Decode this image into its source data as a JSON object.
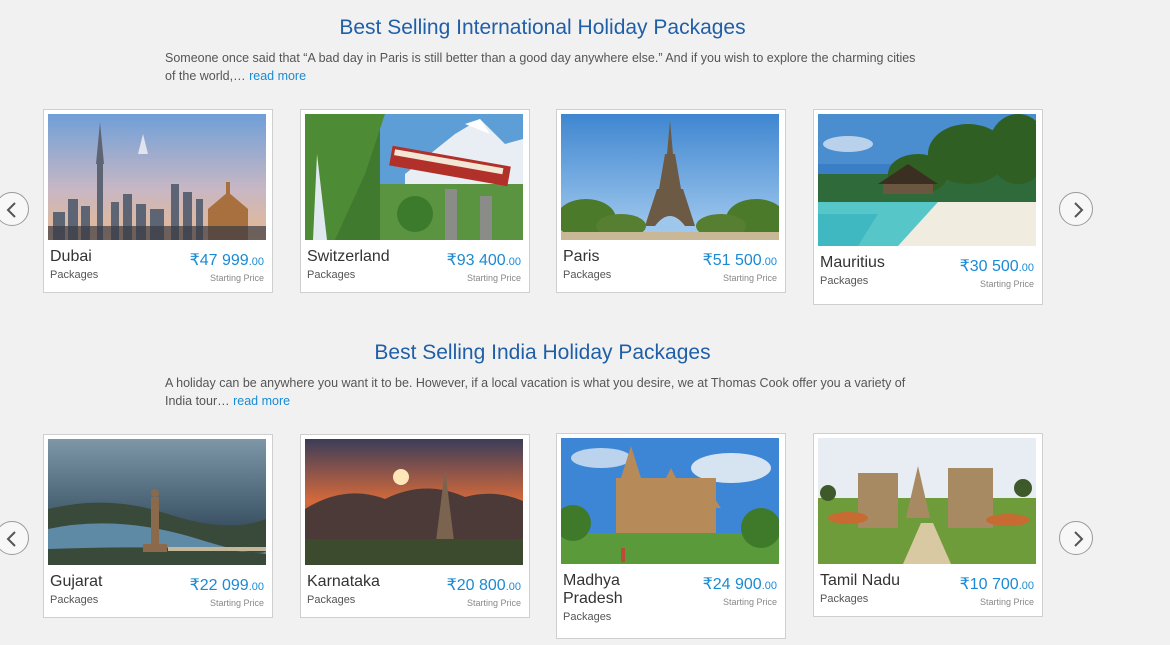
{
  "international": {
    "title": "Best Selling International Holiday Packages",
    "desc": "Someone once said that “A bad day in Paris is still better than a good day anywhere else.” And if you wish to explore the charming cities of the world,…",
    "read_more": "read more",
    "cards": [
      {
        "name": "Dubai",
        "sub": "Packages",
        "price": "₹47 999",
        "dec": ".00",
        "note": "Starting Price"
      },
      {
        "name": "Switzerland",
        "sub": "Packages",
        "price": "₹93 400",
        "dec": ".00",
        "note": "Starting Price"
      },
      {
        "name": "Paris",
        "sub": "Packages",
        "price": "₹51 500",
        "dec": ".00",
        "note": "Starting Price"
      },
      {
        "name": "Mauritius",
        "sub": "Packages",
        "price": "₹30 500",
        "dec": ".00",
        "note": "Starting Price"
      }
    ]
  },
  "india": {
    "title": "Best Selling India Holiday Packages",
    "desc": "A holiday can be anywhere you want it to be. However, if a local vacation is what you desire, we at Thomas Cook offer you a variety of India tour…",
    "read_more": "read more",
    "cards": [
      {
        "name": "Gujarat",
        "sub": "Packages",
        "price": "₹22 099",
        "dec": ".00",
        "note": "Starting Price"
      },
      {
        "name": "Karnataka",
        "sub": "Packages",
        "price": "₹20 800",
        "dec": ".00",
        "note": "Starting Price"
      },
      {
        "name": "Madhya Pradesh",
        "sub": "Packages",
        "price": "₹24 900",
        "dec": ".00",
        "note": "Starting Price"
      },
      {
        "name": "Tamil Nadu",
        "sub": "Packages",
        "price": "₹10 700",
        "dec": ".00",
        "note": "Starting Price"
      }
    ]
  },
  "icons": {
    "prev": "chevron-left-icon",
    "next": "chevron-right-icon"
  },
  "colors": {
    "title": "#1f5fa8",
    "price": "#1a8ad4",
    "link": "#1a8ad4",
    "background": "#f2f1f1"
  }
}
